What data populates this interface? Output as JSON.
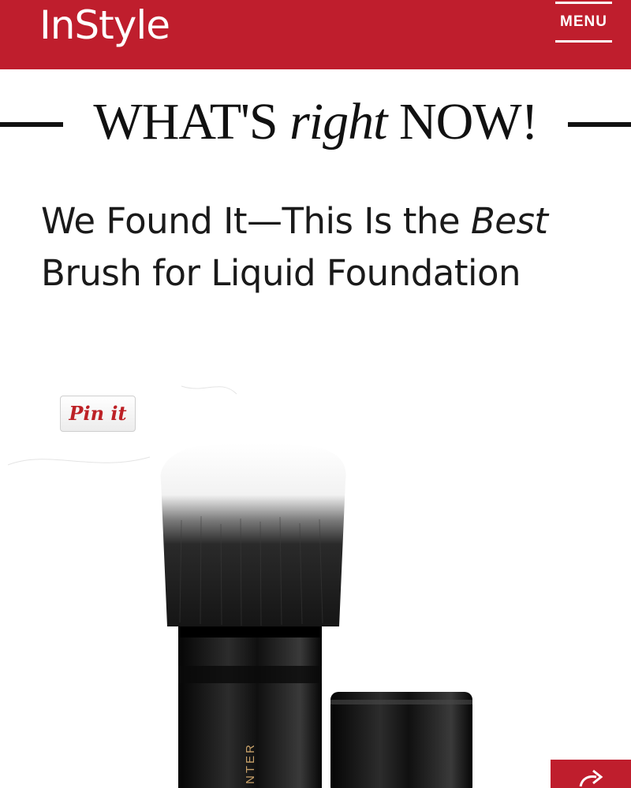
{
  "header": {
    "logo": "InStyle",
    "menu_label": "MENU",
    "color": "#bf1e2d"
  },
  "banner": {
    "part1": "WHAT'S ",
    "part2": "right",
    "part3": " NOW!"
  },
  "article": {
    "headline_line1_a": "We Found It—This Is the ",
    "headline_line1_b": "Best",
    "headline_line2": "Brush for Liquid Foundation"
  },
  "image": {
    "pin_button_label": "Pin it",
    "product_text": "NTER"
  },
  "icons": {
    "menu": "hamburger-menu-icon",
    "share": "share-arrow-icon"
  }
}
